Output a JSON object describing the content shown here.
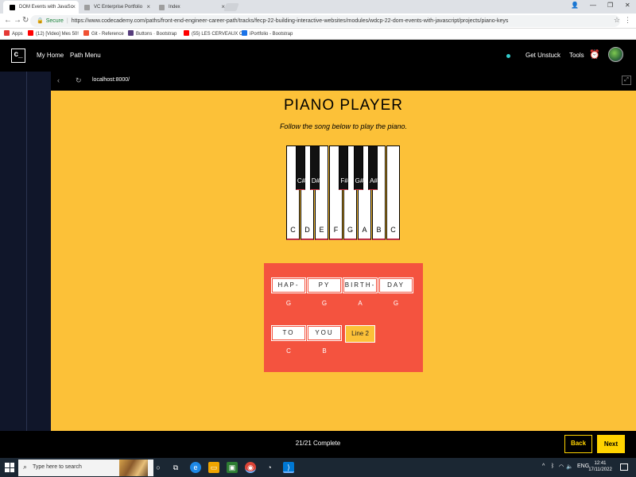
{
  "browser": {
    "tabs": [
      {
        "title": "DOM Events with JavaSc",
        "active": true,
        "icon_color": "#000000"
      },
      {
        "title": "VC Enterprise Portfolio",
        "active": false,
        "icon_color": "#9e9e9e"
      },
      {
        "title": "Index",
        "active": false,
        "icon_color": "#9e9e9e"
      }
    ],
    "url_secure_label": "Secure",
    "url": "https://www.codecademy.com/paths/front-end-engineer-career-path/tracks/fecp-22-building-interactive-websites/modules/wdcp-22-dom-events-with-javascript/projects/piano-keys",
    "bookmarks": [
      {
        "label": "Apps",
        "icon_color": "#e53935"
      },
      {
        "label": "(12) [Video] Mes 50!",
        "icon_color": "#ff0000"
      },
      {
        "label": "Git - Reference",
        "icon_color": "#f05133"
      },
      {
        "label": "Buttons · Bootstrap",
        "icon_color": "#563d7c"
      },
      {
        "label": "(55) LES CERVEAUX C",
        "icon_color": "#ff0000"
      },
      {
        "label": "iPortfolio - Bootstrap",
        "icon_color": "#1a73e8"
      }
    ]
  },
  "codecademy": {
    "logo": "c_",
    "nav": {
      "my_home": "My Home",
      "path_menu": "Path Menu",
      "get_unstuck": "Get Unstuck",
      "tools": "Tools"
    },
    "inner_url": "localhost:8000/",
    "progress": "21/21 Complete",
    "back_label": "Back",
    "next_label": "Next",
    "accent": "#ffd300"
  },
  "app": {
    "title": "PIANO PLAYER",
    "subtitle": "Follow the song below to play the piano.",
    "white_keys": [
      "C",
      "D",
      "E",
      "F",
      "G",
      "A",
      "B",
      "C"
    ],
    "black_keys": [
      "C#",
      "D#",
      "F#",
      "G#",
      "A#"
    ],
    "song": {
      "line1": [
        {
          "word": "HAP-",
          "note": "G"
        },
        {
          "word": "PY",
          "note": "G"
        },
        {
          "word": "BIRTH-",
          "note": "A"
        },
        {
          "word": "DAY",
          "note": "G"
        }
      ],
      "line2": [
        {
          "word": "TO",
          "note": "C"
        },
        {
          "word": "YOU",
          "note": "B"
        }
      ],
      "next_line_button": "Line 2"
    },
    "colors": {
      "background": "#fcc138",
      "song_panel": "#f4533f"
    }
  },
  "taskbar": {
    "search_placeholder": "Type here to search",
    "language": "ENG",
    "time": "12:41",
    "date": "17/11/2022"
  }
}
